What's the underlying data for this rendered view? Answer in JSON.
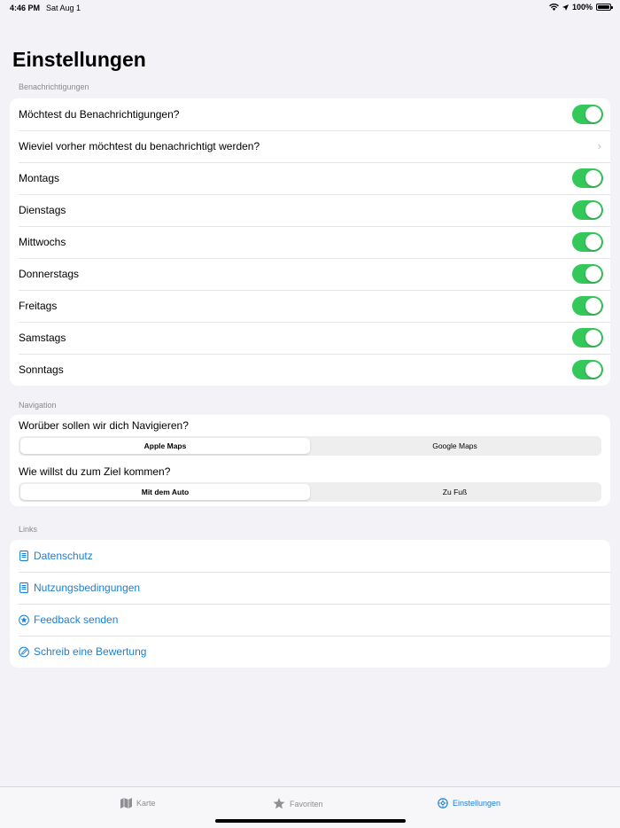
{
  "status": {
    "time": "4:46 PM",
    "date": "Sat Aug 1",
    "battery": "100%"
  },
  "title": "Einstellungen",
  "notifications": {
    "header": "Benachrichtigungen",
    "rows": [
      {
        "label": "Möchtest du Benachrichtigungen?",
        "type": "toggle",
        "on": true
      },
      {
        "label": "Wieviel vorher möchtest du benachrichtigt werden?",
        "type": "chevron"
      },
      {
        "label": "Montags",
        "type": "toggle",
        "on": true
      },
      {
        "label": "Dienstags",
        "type": "toggle",
        "on": true
      },
      {
        "label": "Mittwochs",
        "type": "toggle",
        "on": true
      },
      {
        "label": "Donnerstags",
        "type": "toggle",
        "on": true
      },
      {
        "label": "Freitags",
        "type": "toggle",
        "on": true
      },
      {
        "label": "Samstags",
        "type": "toggle",
        "on": true
      },
      {
        "label": "Sonntags",
        "type": "toggle",
        "on": true
      }
    ]
  },
  "navigation": {
    "header": "Navigation",
    "q1": "Worüber sollen wir dich Navigieren?",
    "q1_options": [
      "Apple Maps",
      "Google Maps"
    ],
    "q1_selected": "Apple Maps",
    "q2": "Wie willst du zum Ziel kommen?",
    "q2_options": [
      "Mit dem Auto",
      "Zu Fuß"
    ],
    "q2_selected": "Mit dem Auto"
  },
  "links": {
    "header": "Links",
    "items": [
      {
        "label": "Datenschutz",
        "icon": "document-icon"
      },
      {
        "label": "Nutzungsbedingungen",
        "icon": "document-icon"
      },
      {
        "label": "Feedback senden",
        "icon": "star-circle-icon"
      },
      {
        "label": "Schreib eine Bewertung",
        "icon": "pencil-circle-icon"
      }
    ]
  },
  "tabbar": {
    "tabs": [
      {
        "label": "Karte",
        "icon": "map-icon"
      },
      {
        "label": "Favoriten",
        "icon": "star-icon"
      },
      {
        "label": "Einstellungen",
        "icon": "gear-icon"
      }
    ],
    "active": "Einstellungen"
  },
  "colors": {
    "accent": "#1a7fd6",
    "toggle_on": "#34c759",
    "background": "#f2f2f7"
  }
}
